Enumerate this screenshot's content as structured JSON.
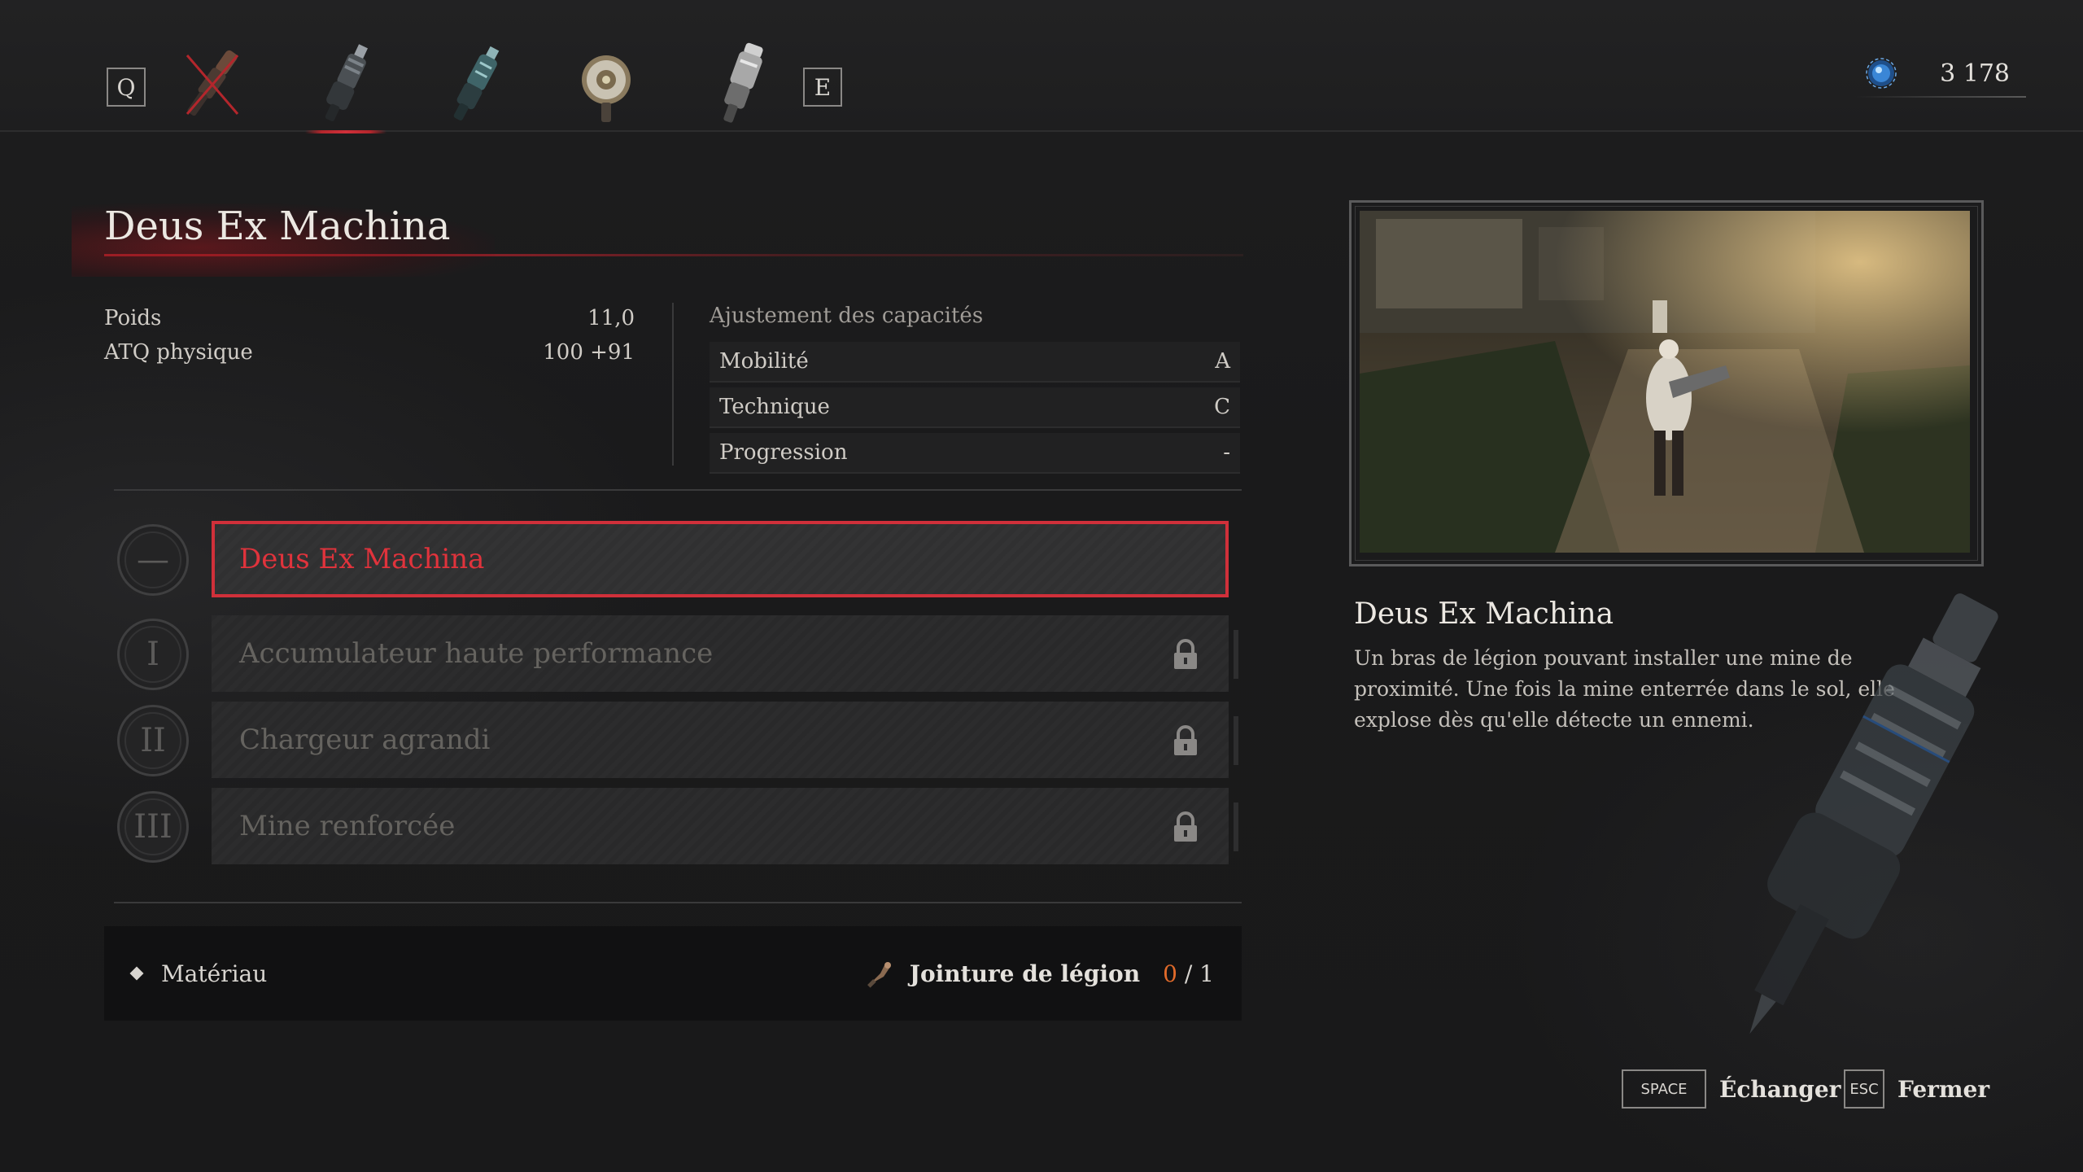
{
  "topbar": {
    "prev_key": "Q",
    "next_key": "E",
    "weapon_slots": [
      {
        "icon": "crossed-out-arm-icon",
        "state": "unavailable"
      },
      {
        "icon": "mine-launcher-arm-icon",
        "state": "selected"
      },
      {
        "icon": "blade-arm-icon",
        "state": "normal"
      },
      {
        "icon": "shield-arm-icon",
        "state": "normal"
      },
      {
        "icon": "flamethrower-arm-icon",
        "state": "normal"
      }
    ],
    "currency": {
      "icon": "ergo-crystal-icon",
      "amount": "3 178"
    }
  },
  "item": {
    "title": "Deus Ex Machina"
  },
  "stats": {
    "rows": [
      {
        "label": "Poids",
        "value": "11,0"
      },
      {
        "label": "ATQ physique",
        "value": "100 +91"
      }
    ],
    "scaling_heading": "Ajustement des capacités",
    "scaling": [
      {
        "label": "Mobilité",
        "value": "A"
      },
      {
        "label": "Technique",
        "value": "C"
      },
      {
        "label": "Progression",
        "value": "-"
      }
    ]
  },
  "upgrades": [
    {
      "rank": "—",
      "label": "Deus Ex Machina",
      "selected": true,
      "locked": false
    },
    {
      "rank": "I",
      "label": "Accumulateur haute performance",
      "selected": false,
      "locked": true
    },
    {
      "rank": "II",
      "label": "Chargeur agrandi",
      "selected": false,
      "locked": true
    },
    {
      "rank": "III",
      "label": "Mine renforcée",
      "selected": false,
      "locked": true
    }
  ],
  "material": {
    "label": "Matériau",
    "required_item": "Jointure de légion",
    "have": "0",
    "separator": "/",
    "need": "1"
  },
  "preview": {
    "name": "Deus Ex Machina",
    "description": "Un bras de légion pouvant installer une mine de proximité. Une fois la mine enterrée dans le sol, elle explose dès qu'elle détecte un ennemi."
  },
  "footer": {
    "swap_key": "SPACE",
    "swap_label": "Échanger",
    "close_key": "ESC",
    "close_label": "Fermer"
  },
  "colors": {
    "accent_red": "#d0303a",
    "material_count": "#e06a2a",
    "background": "#1a1a1b"
  }
}
